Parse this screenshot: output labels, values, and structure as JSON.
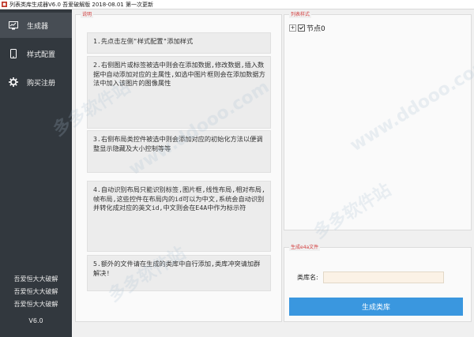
{
  "window": {
    "title": "列表类库生成器V6.0 吾爱破解版 2018-08.01 第一次更新"
  },
  "sidebar": {
    "items": [
      {
        "label": "生成器",
        "icon": "monitor-chart-icon"
      },
      {
        "label": "样式配置",
        "icon": "phone-icon"
      },
      {
        "label": "购买注册",
        "icon": "gear-icon"
      }
    ],
    "footer": [
      "吾爱恒大大破解",
      "吾爱恒大大破解",
      "吾爱恒大大破解"
    ],
    "version": "V6.0"
  },
  "instructions": {
    "label": "说明",
    "notes": [
      "1.先点击左侧\"样式配置\"添加样式",
      "2.右侧图片或标签被选中则会在添加数据,修改数据,插入数据中自动添加对应的主属性,如选中图片框则会在添加数据方法中加入该图片的图像属性",
      "3.右侧布局类控件被选中则会添加对应的初始化方法以便调整显示隐藏及大小控制等等",
      "4.自动识别布局只能识别标签,图片框,线性布局,相对布局,帧布局,这些控件在布局内的id可以为中文,系统会自动识别并转化成对应的英文id,中文则会在E4A中作为标示符",
      "5.额外的文件请在生成的类库中自行添加,类库冲突请加群解决!"
    ]
  },
  "list_style": {
    "label": "列表样式",
    "tree": [
      {
        "label": "节点0",
        "checked": true
      }
    ]
  },
  "generate": {
    "label": "生成e4a文件",
    "class_name_label": "类库名:",
    "class_name_value": "",
    "button_label": "生成类库"
  },
  "watermarks": [
    "多多软件站",
    "www.ddooo.com"
  ],
  "colors": {
    "sidebar": "#32383e",
    "sidebar_active": "#474d54",
    "button": "#3a97df",
    "input_bg": "#fbf2e6",
    "group_label": "#d23c3c"
  }
}
